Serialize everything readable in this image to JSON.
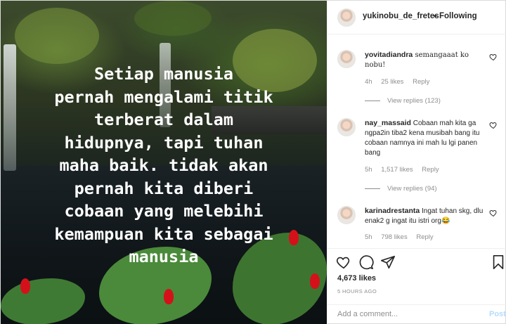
{
  "photo": {
    "caption": "Setiap manusia\npernah mengalami titik\nterberat dalam\nhidupnya, tapi tuhan\nmaha baik. tidak akan\npernah kita diberi\ncobaan yang melebihi\nkemampuan kita sebagai\nmanusia"
  },
  "header": {
    "username": "yukinobu_de_fretes",
    "separator": "•",
    "follow_label": "Following"
  },
  "comments": [
    {
      "user": "yovitadiandra",
      "text": "semangaaat ko nobu!",
      "time": "4h",
      "likes": "25 likes",
      "reply_label": "Reply",
      "view_replies": "View replies (123)"
    },
    {
      "user": "nay_massaid",
      "text": "Cobaan mah kita ga ngpa2in tiba2 kena musibah bang itu cobaan namnya ini mah lu lgi panen bang",
      "time": "5h",
      "likes": "1,517 likes",
      "reply_label": "Reply",
      "view_replies": "View replies (94)"
    },
    {
      "user": "karinadrestanta",
      "text": "Ingat tuhan skg, dlu enak2 g ingat itu istri org😂",
      "time": "5h",
      "likes": "798 likes",
      "reply_label": "Reply"
    }
  ],
  "actions": {
    "likes": "4,673 likes",
    "time": "5 HOURS AGO"
  },
  "add_comment": {
    "placeholder": "Add a comment...",
    "post_label": "Post"
  },
  "icons": {
    "like": "heart-icon",
    "comment": "comment-icon",
    "share": "share-icon",
    "save": "bookmark-icon"
  },
  "colors": {
    "text": "#262626",
    "muted": "#8e8e8e",
    "border": "#dbdbdb",
    "post_disabled": "#b3dbff"
  }
}
